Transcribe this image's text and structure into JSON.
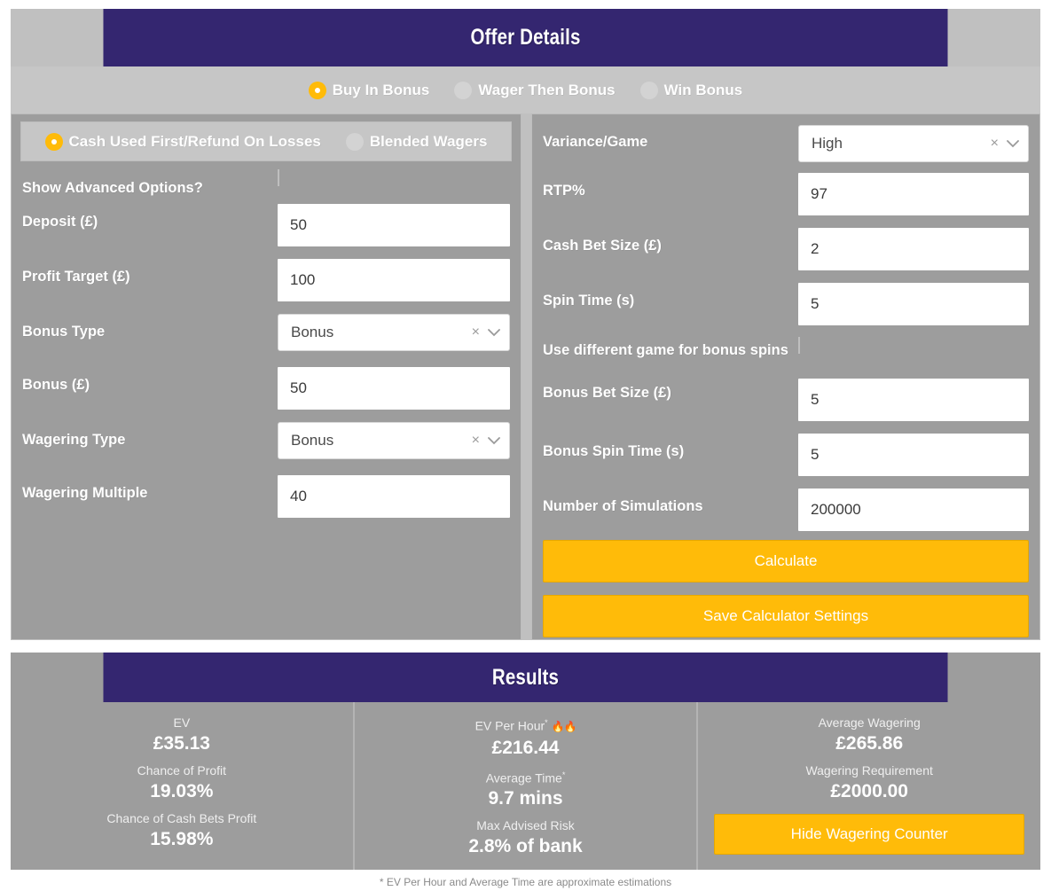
{
  "theme": {
    "header_purple": "#342670",
    "panel_gray": "#9d9d9d",
    "strip_gray": "#c6c6c6",
    "accent_orange": "#FFBB09",
    "text_white": "#ffffff"
  },
  "offer": {
    "title": "Offer Details",
    "offer_types": [
      {
        "label": "Buy In Bonus",
        "selected": true
      },
      {
        "label": "Wager Then Bonus",
        "selected": false
      },
      {
        "label": "Win Bonus",
        "selected": false
      }
    ],
    "left": {
      "modes": [
        {
          "label": "Cash Used First/Refund On Losses",
          "selected": true
        },
        {
          "label": "Blended Wagers",
          "selected": false
        }
      ],
      "fields": {
        "show_advanced_label": "Show Advanced Options?",
        "show_advanced_checked": false,
        "deposit_label": "Deposit (£)",
        "deposit_value": "50",
        "profit_target_label": "Profit Target (£)",
        "profit_target_value": "100",
        "bonus_type_label": "Bonus Type",
        "bonus_type_value": "Bonus",
        "bonus_label": "Bonus (£)",
        "bonus_value": "50",
        "wagering_type_label": "Wagering Type",
        "wagering_type_value": "Bonus",
        "wagering_multiple_label": "Wagering Multiple",
        "wagering_multiple_value": "40"
      }
    },
    "right": {
      "fields": {
        "variance_label": "Variance/Game",
        "variance_value": "High",
        "rtp_label": "RTP%",
        "rtp_value": "97",
        "cash_bet_size_label": "Cash Bet Size (£)",
        "cash_bet_size_value": "2",
        "spin_time_label": "Spin Time (s)",
        "spin_time_value": "5",
        "diff_game_label": "Use different game for bonus spins",
        "diff_game_checked": false,
        "bonus_bet_size_label": "Bonus Bet Size (£)",
        "bonus_bet_size_value": "5",
        "bonus_spin_time_label": "Bonus Spin Time (s)",
        "bonus_spin_time_value": "5",
        "num_sims_label": "Number of Simulations",
        "num_sims_value": "200000"
      },
      "buttons": {
        "calculate": "Calculate",
        "save_settings": "Save Calculator Settings"
      }
    },
    "select_icons": {
      "clear": "×",
      "chevron": "⌄"
    }
  },
  "results": {
    "title": "Results",
    "columns": [
      {
        "items": [
          {
            "caption": "EV",
            "value": "£35.13"
          },
          {
            "caption": "Chance of Profit",
            "value": "19.03%"
          },
          {
            "caption": "Chance of Cash Bets Profit",
            "value": "15.98%"
          }
        ]
      },
      {
        "items": [
          {
            "caption": "EV Per Hour",
            "sup": "*",
            "fire": "🔥🔥",
            "value": "£216.44"
          },
          {
            "caption": "Average Time",
            "sup": "*",
            "value": "9.7 mins"
          },
          {
            "caption": "Max Advised Risk",
            "value": "2.8% of bank"
          }
        ]
      },
      {
        "items": [
          {
            "caption": "Average Wagering",
            "value": "£265.86"
          },
          {
            "caption": "Wagering Requirement",
            "value": "£2000.00"
          }
        ],
        "button": "Hide Wagering Counter"
      }
    ]
  },
  "footnote": "* EV Per Hour and Average Time are approximate estimations"
}
